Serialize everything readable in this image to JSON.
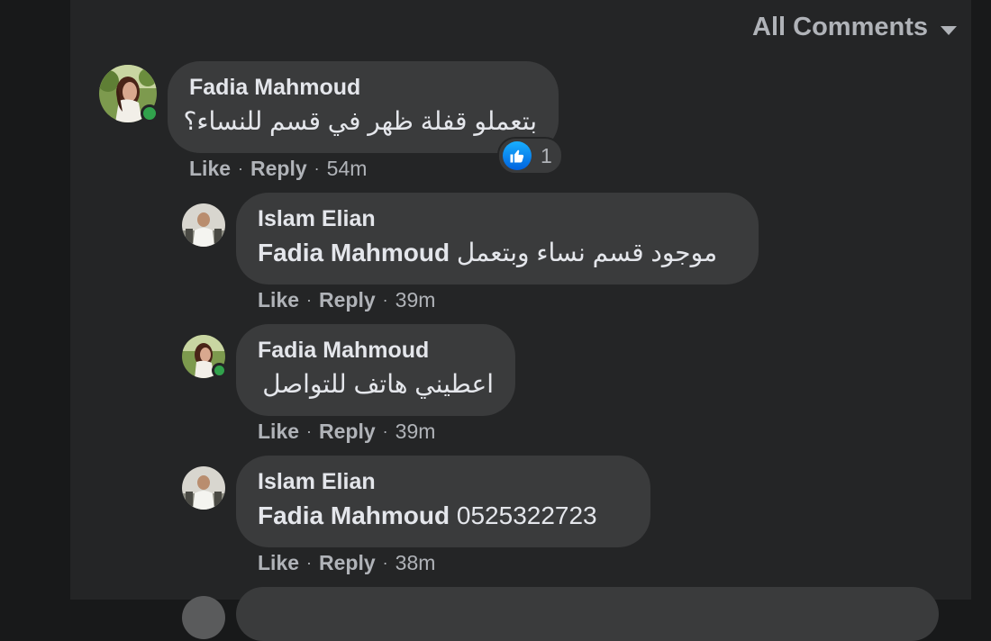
{
  "header": {
    "sort_label": "All Comments"
  },
  "comments": [
    {
      "author": "Fadia Mahmoud",
      "text": "بتعملو قفلة ظهر في قسم للنساء؟",
      "like": "Like",
      "reply": "Reply",
      "time": "54m",
      "reactions": {
        "count": "1"
      }
    },
    {
      "author": "Islam Elian",
      "mention": "Fadia Mahmoud",
      "text": "موجود قسم نساء وبتعمل",
      "like": "Like",
      "reply": "Reply",
      "time": "39m"
    },
    {
      "author": "Fadia Mahmoud",
      "text": "اعطيني هاتف للتواصل",
      "like": "Like",
      "reply": "Reply",
      "time": "39m"
    },
    {
      "author": "Islam Elian",
      "mention": "Fadia Mahmoud",
      "text": "0525322723",
      "like": "Like",
      "reply": "Reply",
      "time": "38m"
    }
  ],
  "colors": {
    "background": "#18191a",
    "panel": "#242526",
    "bubble": "#3a3b3c",
    "online": "#31a24c",
    "like": "#1877f2"
  },
  "icons": [
    "caret-down-icon",
    "like-icon"
  ]
}
